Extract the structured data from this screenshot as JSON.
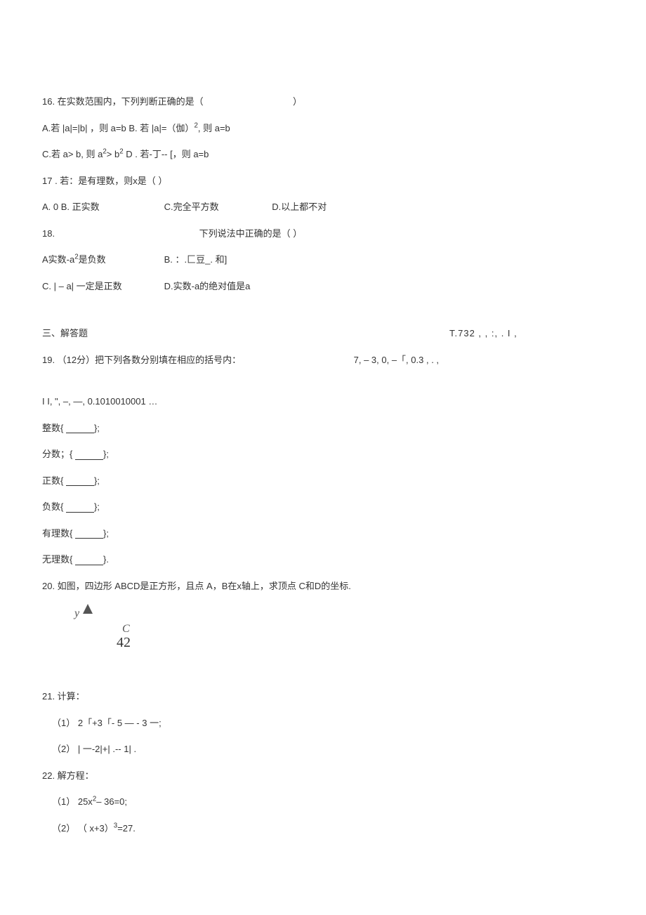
{
  "q16": {
    "stem_pre": "16. 在实数范围内，下列判断正确的是（",
    "stem_post": "）",
    "a_pre": "A.若 |a|=|b| ，则 a=b B. 若 |a|=（伽）",
    "a_sup": "2",
    "a_post": ", 则 a=b",
    "c_pre": "C.若 a> b, 则 a",
    "c_sup1": "2",
    "c_mid": "> b",
    "c_sup2": "2",
    "c_post": " D . 若-丁-- [，则 a=b"
  },
  "q17": {
    "stem": "17 . 若：是有理数，则x是（  ）",
    "a": "A. 0 B. 正实数",
    "c": "C.完全平方数",
    "d": "D.以上都不对"
  },
  "q18": {
    "num": "18.",
    "stem": "下列说法中正确的是（      ）",
    "a": "A实数-a",
    "a_sup": "2",
    "a_post": "是负数",
    "b": "B. ：.匚豆_. 和]",
    "c": "C. | – a| 一定是正数",
    "d": "D.实数-a的绝对值是a"
  },
  "section3": "三、解答题",
  "q19": {
    "stem": "19.   （12分）把下列各数分别填在相应的括号内：",
    "right_top": "T.732 ,         ,   :,       . I ,",
    "right_bot": "7,  – 3,  0,  –「,  0.3 , . ,",
    "line2": "I  I,   \",  –,   —,    0.1010010001 …",
    "f1_pre": "整数{ ",
    "f1_post": "};",
    "f2_pre": "分数；{ ",
    "f2_post": "};",
    "f3_pre": "正数{ ",
    "f3_post": "};",
    "f4_pre": "负数{ ",
    "f4_post": "};",
    "f5_pre": "有理数{ ",
    "f5_post": "};",
    "f6_pre": "无理数{ ",
    "f6_post": "}."
  },
  "q20": {
    "stem": "20.   如图，四边形 ABCD是正方形，且点 A，B在x轴上，求顶点 C和D的坐标.",
    "y": "y",
    "c": "C",
    "n": "42"
  },
  "q21": {
    "stem": "21.   计算：",
    "p1": "（1）  2「+3「- 5 — - 3 一;",
    "p2": "（2）  | 一-2|+| .-- 1| ."
  },
  "q22": {
    "stem": "22.   解方程：",
    "p1_pre": "（1）  25x",
    "p1_sup": "2",
    "p1_post": "– 36=0;",
    "p2_pre": "（2）  （ x+3）",
    "p2_sup": "3",
    "p2_post": "=27."
  }
}
